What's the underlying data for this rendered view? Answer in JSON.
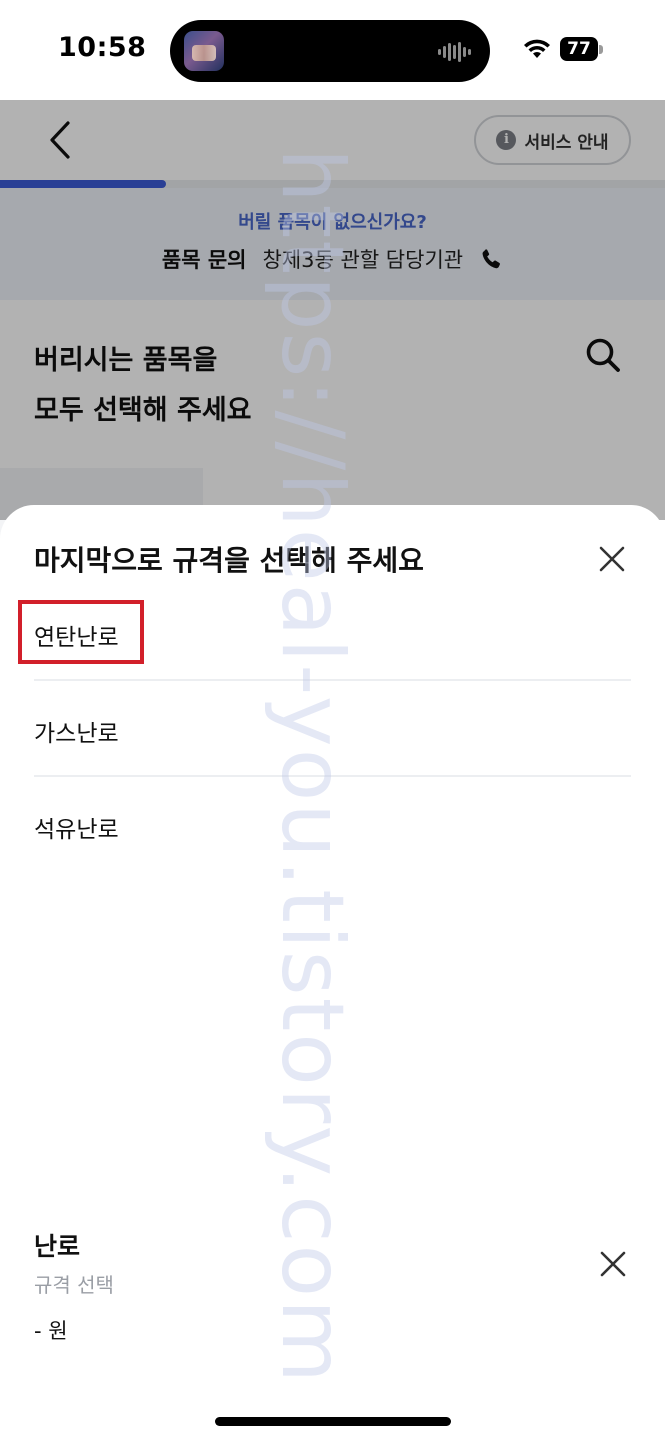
{
  "status_bar": {
    "time": "10:58",
    "battery": "77"
  },
  "header": {
    "service_guide_label": "서비스 안내",
    "progress": 0.25
  },
  "inquiry_banner": {
    "question": "버릴 품목이 없으신가요?",
    "label": "품목 문의",
    "agency": "창제3동 관할 담당기관"
  },
  "page": {
    "title_line1": "버리시는 품목을",
    "title_line2": "모두 선택해 주세요"
  },
  "sheet": {
    "title": "마지막으로 규격을 선택해 주세요",
    "options": [
      {
        "label": "연탄난로"
      },
      {
        "label": "가스난로"
      },
      {
        "label": "석유난로"
      }
    ]
  },
  "selection": {
    "name": "난로",
    "spec": "규격 선택",
    "price": "- 원"
  },
  "watermark": "https://heal-you.tistory.com",
  "colors": {
    "accent": "#3c5bd6",
    "highlight": "#d21f2a",
    "banner_bg": "#eef2f9",
    "banner_question": "#4a67c9"
  }
}
